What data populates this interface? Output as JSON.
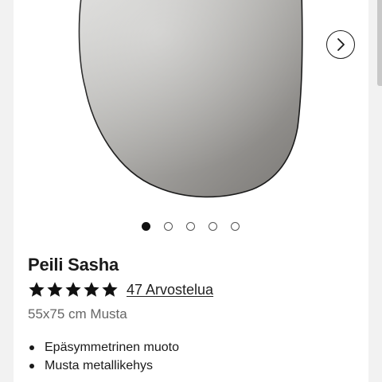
{
  "product": {
    "title": "Peili Sasha",
    "rating": {
      "stars": 5,
      "max": 5,
      "reviews_label": "47 Arvostelua"
    },
    "variant": "55x75 cm Musta",
    "features": [
      "Epäsymmetrinen muoto",
      "Musta metallikehys"
    ]
  },
  "gallery": {
    "image_name": "mirror-image",
    "next_icon": "chevron-right-icon",
    "slide_count": 5,
    "active_slide": 1
  },
  "colors": {
    "background": "#f2f2f2",
    "card": "#ffffff",
    "text": "#1a1a1a",
    "muted": "#666666",
    "accent": "#111111"
  }
}
